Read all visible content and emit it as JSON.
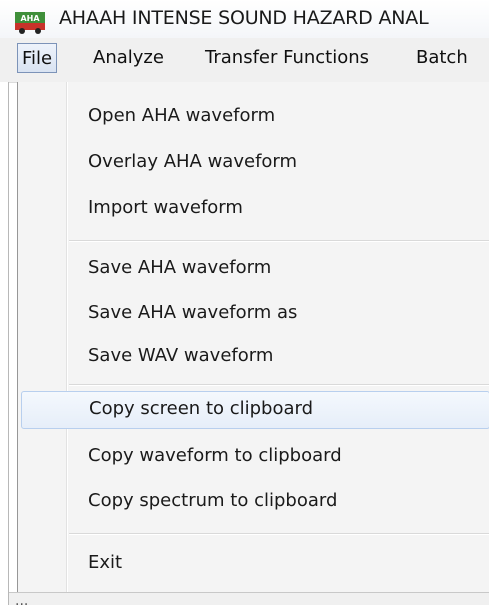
{
  "window": {
    "title": "AHAAH INTENSE SOUND HAZARD ANAL",
    "icon": "aha-app-icon",
    "icon_text": "AHA"
  },
  "menubar": {
    "items": [
      {
        "label": "File",
        "active": true
      },
      {
        "label": "Analyze"
      },
      {
        "label": "Transfer Functions"
      },
      {
        "label": "Batch"
      }
    ]
  },
  "file_menu": {
    "items": [
      {
        "label": "Open AHA waveform"
      },
      {
        "label": "Overlay AHA waveform"
      },
      {
        "label": "Import waveform"
      },
      {
        "label": "Save AHA waveform"
      },
      {
        "label": "Save AHA waveform as"
      },
      {
        "label": "Save WAV waveform"
      },
      {
        "label": "Copy screen to clipboard",
        "highlighted": true
      },
      {
        "label": "Copy waveform to clipboard"
      },
      {
        "label": "Copy spectrum to clipboard"
      },
      {
        "label": "Exit"
      }
    ]
  },
  "status": {
    "text": "..."
  },
  "colors": {
    "menu_background": "#f4f4f4",
    "highlight_fill": "#e6eef9",
    "highlight_border": "#b8cfee",
    "active_menu_border": "#7c93b8"
  }
}
